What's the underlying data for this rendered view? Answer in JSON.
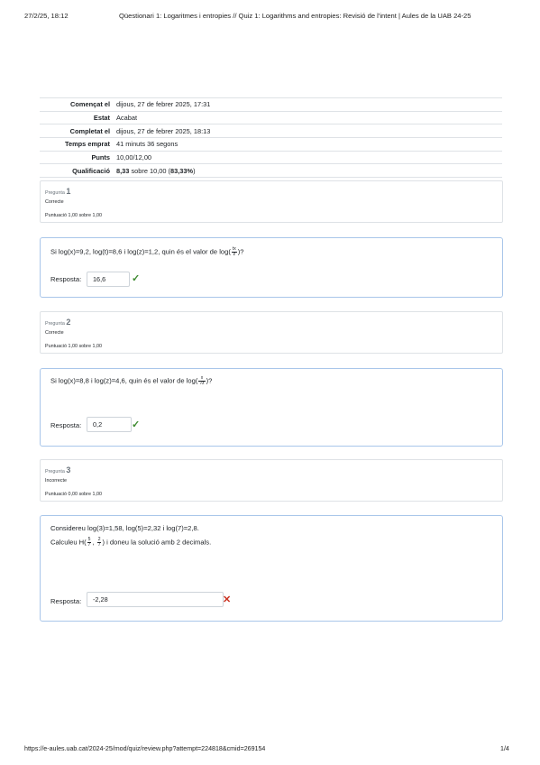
{
  "header": {
    "date": "27/2/25, 18:12",
    "title": "Qüestionari 1: Logaritmes i entropies // Quiz 1: Logarithms and entropies: Revisió de l'intent | Aules de la UAB 24-25"
  },
  "summary": [
    {
      "key": "Començat el",
      "value": "dijous, 27 de febrer 2025, 17:31"
    },
    {
      "key": "Estat",
      "value": "Acabat"
    },
    {
      "key": "Completat el",
      "value": "dijous, 27 de febrer 2025, 18:13"
    },
    {
      "key": "Temps emprat",
      "value": "41 minuts 36 segons"
    },
    {
      "key": "Punts",
      "value": "10,00/12,00"
    },
    {
      "key": "Qualificació",
      "value_bold": "8,33",
      "value_mid": " sobre 10,00 (",
      "value_pct": "83,33%",
      "value_end": ")"
    }
  ],
  "questions": [
    {
      "label": "Pregunta",
      "number": "1",
      "state": "Correcte",
      "grade": "Puntuació 1,00 sobre 1,00",
      "text_pre": "Si log(x)=9,2, log(t)=8,6 i log(z)=1,2, quin és el valor de log(",
      "frac_num": "tx",
      "frac_den": "z",
      "text_post": ")?",
      "answer_label": "Resposta:",
      "answer": "16,6",
      "mark": "✓"
    },
    {
      "label": "Pregunta",
      "number": "2",
      "state": "Correcte",
      "grade": "Puntuació 1,00 sobre 1,00",
      "text_pre": "Si log(x)=8,8 i log(z)=4,6, quin és el valor de log(",
      "frac_num": "x",
      "frac_den": "√z",
      "text_post": ")?",
      "answer_label": "Resposta:",
      "answer": "0,2",
      "mark": "✓"
    },
    {
      "label": "Pregunta",
      "number": "3",
      "state": "Incorrecte",
      "grade": "Puntuació 0,00 sobre 1,00",
      "text_line1": "Considereu log(3)=1,58, log(5)=2,32 i log(7)=2,8.",
      "text_pre": "Calculeu H(",
      "frac1_num": "5",
      "frac1_den": "7",
      "separator": ", ",
      "frac2_num": "2",
      "frac2_den": "7",
      "text_post": ") i doneu la solució amb 2 decimals.",
      "answer_label": "Resposta:",
      "answer": "-2,28",
      "mark": "✕"
    }
  ],
  "footer": {
    "url": "https://e-aules.uab.cat/2024-25/mod/quiz/review.php?attempt=224818&cmid=269154",
    "page": "1/4"
  }
}
